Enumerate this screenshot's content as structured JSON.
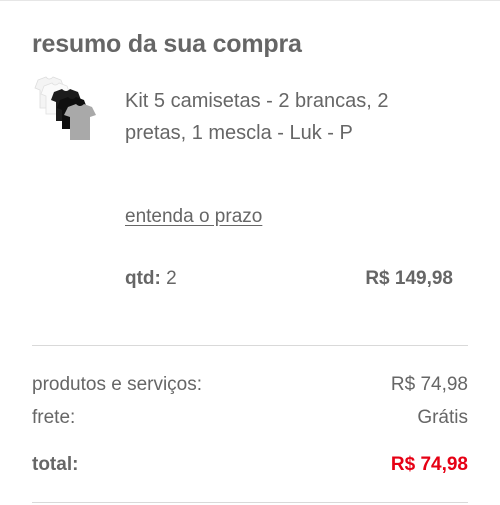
{
  "summary": {
    "title": "resumo da sua compra"
  },
  "item": {
    "image_icon": "tshirt-kit-thumbnail",
    "name": "Kit 5 camisetas - 2 brancas, 2 pretas, 1 mescla - Luk - P",
    "deadline_link": "entenda o prazo",
    "qty_label": "qtd:",
    "qty_value": "2",
    "price": "R$ 149,98"
  },
  "totals": {
    "products_label": "produtos e serviços:",
    "products_value": "R$ 74,98",
    "shipping_label": "frete:",
    "shipping_value": "Grátis",
    "total_label": "total:",
    "total_value": "R$ 74,98"
  },
  "colors": {
    "text": "#666666",
    "total_accent": "#e60014",
    "divider": "#d9d9d9"
  }
}
